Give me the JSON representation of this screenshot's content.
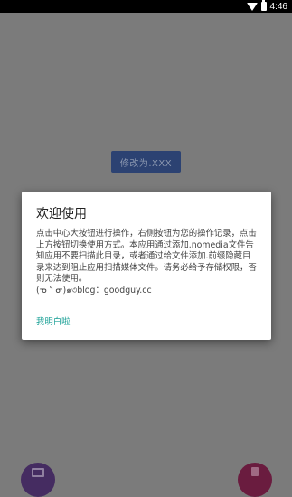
{
  "status_bar": {
    "time": "4:46"
  },
  "main": {
    "modify_button_label": "修改为.XXX"
  },
  "dialog": {
    "title": "欢迎使用",
    "message": "点击中心大按钮进行操作，右侧按钮为您的操作记录，点击上方按钮切换使用方式。本应用通过添加.nomedia文件告知应用不要扫描此目录，或者通过给文件添加.前缀隐藏目录来达到阻止应用扫描媒体文件。请务必给予存储权限，否则无法使用。\n(ᓀ ᕐ ᓂ)๑৩blog：goodguy.cc",
    "confirm_label": "我明白啦"
  },
  "colors": {
    "scrim": "#7b7b7b",
    "primary_button": "#2c4272",
    "accent": "#1aa096",
    "fab_left": "#452c61",
    "fab_right": "#6a1c3f"
  },
  "icons": {
    "wifi": "wifi-icon",
    "battery": "battery-icon",
    "fab_left": "history-icon",
    "fab_right": "delete-icon"
  }
}
